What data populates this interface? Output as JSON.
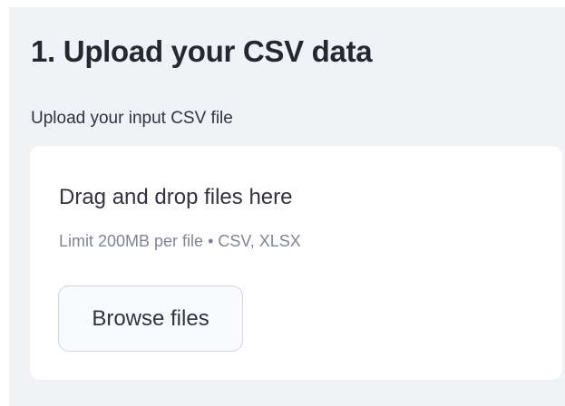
{
  "section": {
    "heading": "1. Upload your CSV data"
  },
  "uploader": {
    "label": "Upload your input CSV file",
    "dropzone_title": "Drag and drop files here",
    "limit_text": "Limit 200MB per file • CSV, XLSX",
    "browse_label": "Browse files"
  }
}
